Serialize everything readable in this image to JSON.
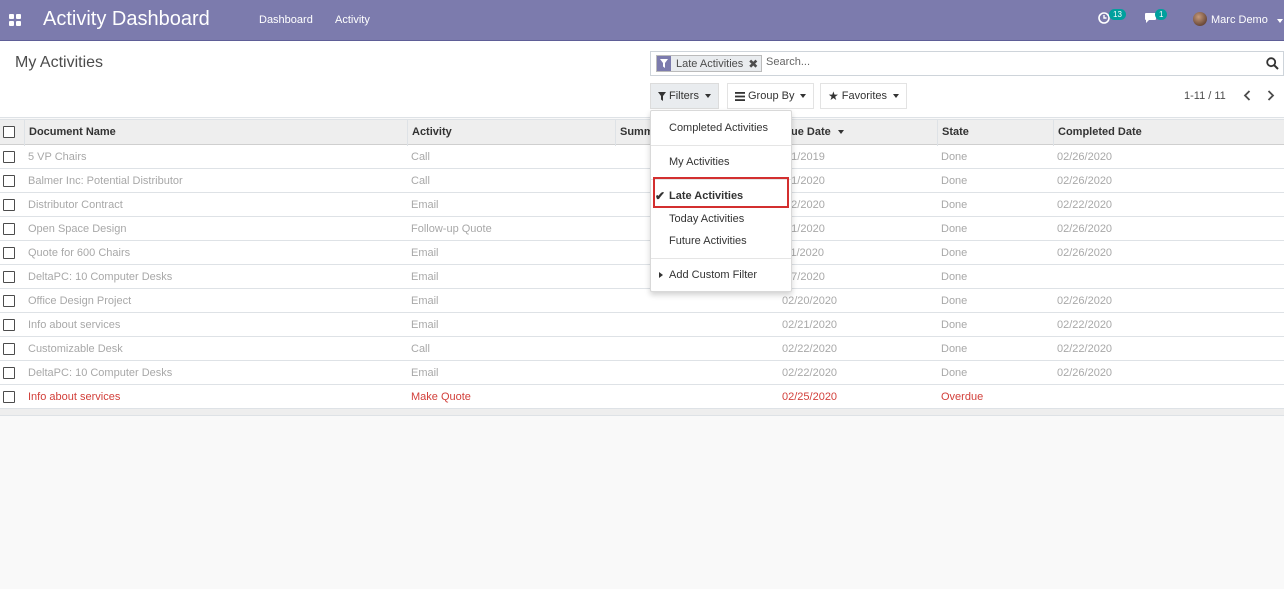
{
  "navbar": {
    "title": "Activity Dashboard",
    "links": [
      "Dashboard",
      "Activity"
    ],
    "activity_count": "13",
    "message_count": "1",
    "user": "Marc Demo"
  },
  "control_panel": {
    "title": "My Activities",
    "facet_label": "Late Activities",
    "search_placeholder": "Search...",
    "filters_label": "Filters",
    "groupby_label": "Group By",
    "favorites_label": "Favorites",
    "pager": "1-11 / 11"
  },
  "filter_menu": {
    "items": [
      {
        "label": "Completed Activities",
        "selected": false
      },
      {
        "label": "My Activities",
        "selected": false
      },
      {
        "label": "Late Activities",
        "selected": true
      },
      {
        "label": "Today Activities",
        "selected": false
      },
      {
        "label": "Future Activities",
        "selected": false
      }
    ],
    "custom_filter": "Add Custom Filter"
  },
  "table": {
    "columns": [
      "Document Name",
      "Activity",
      "Summ",
      "ue Date",
      "State",
      "Completed Date"
    ],
    "rows": [
      {
        "doc": "5 VP Chairs",
        "activity": "Call",
        "due": "/01/2019",
        "state": "Done",
        "completed": "02/26/2020",
        "overdue": false
      },
      {
        "doc": "Balmer Inc: Potential Distributor",
        "activity": "Call",
        "due": "/01/2020",
        "state": "Done",
        "completed": "02/26/2020",
        "overdue": false
      },
      {
        "doc": "Distributor Contract",
        "activity": "Email",
        "due": "/22/2020",
        "state": "Done",
        "completed": "02/22/2020",
        "overdue": false
      },
      {
        "doc": "Open Space Design",
        "activity": "Follow-up Quote",
        "due": "/01/2020",
        "state": "Done",
        "completed": "02/26/2020",
        "overdue": false
      },
      {
        "doc": "Quote for 600 Chairs",
        "activity": "Email",
        "due": "/11/2020",
        "state": "Done",
        "completed": "02/26/2020",
        "overdue": false
      },
      {
        "doc": "DeltaPC: 10 Computer Desks",
        "activity": "Email",
        "due": "/17/2020",
        "state": "Done",
        "completed": "",
        "overdue": false
      },
      {
        "doc": "Office Design Project",
        "activity": "Email",
        "due": "02/20/2020",
        "state": "Done",
        "completed": "02/26/2020",
        "overdue": false
      },
      {
        "doc": "Info about services",
        "activity": "Email",
        "due": "02/21/2020",
        "state": "Done",
        "completed": "02/22/2020",
        "overdue": false
      },
      {
        "doc": "Customizable Desk",
        "activity": "Call",
        "due": "02/22/2020",
        "state": "Done",
        "completed": "02/22/2020",
        "overdue": false
      },
      {
        "doc": "DeltaPC: 10 Computer Desks",
        "activity": "Email",
        "due": "02/22/2020",
        "state": "Done",
        "completed": "02/26/2020",
        "overdue": false
      },
      {
        "doc": "Info about services",
        "activity": "Make Quote",
        "due": "02/25/2020",
        "state": "Overdue",
        "completed": "",
        "overdue": true
      }
    ]
  },
  "colors": {
    "navbar": "#7c7bad",
    "badge": "#00a09d",
    "overdue": "#d23f3a",
    "highlight": "#d32f2f"
  }
}
